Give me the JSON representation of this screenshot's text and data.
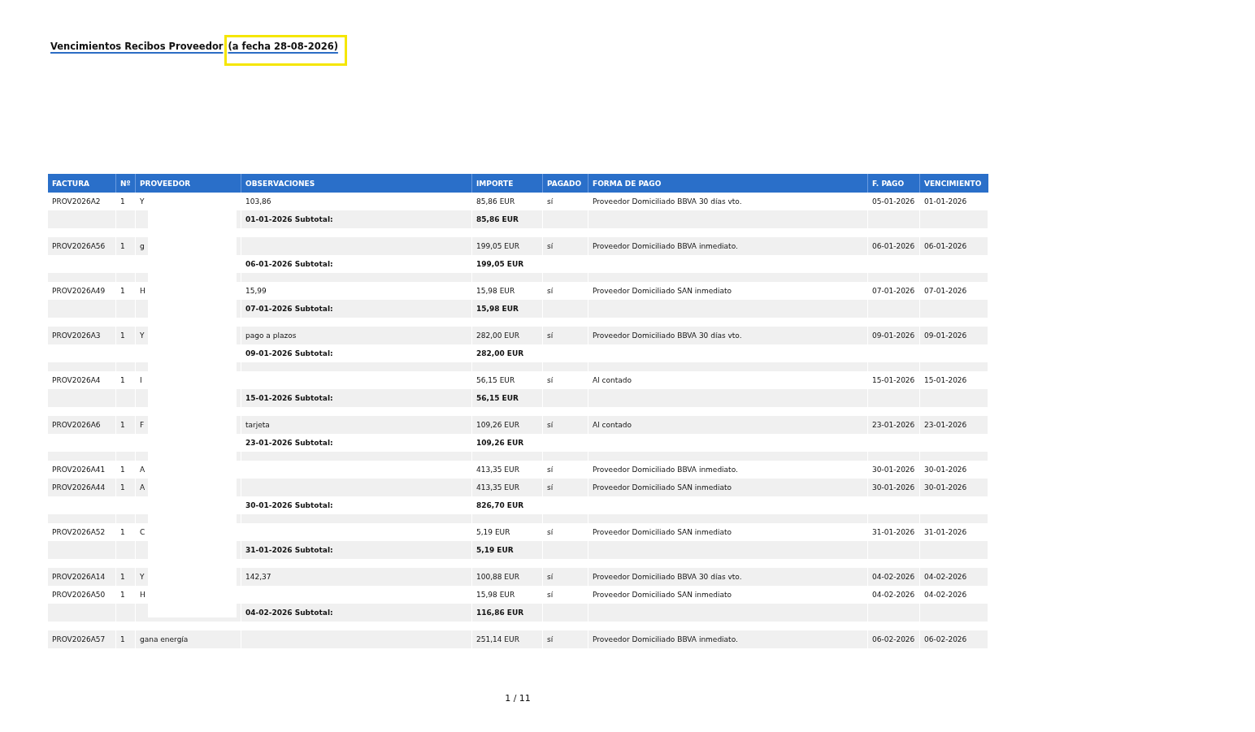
{
  "title": "Vencimientos Recibos Proveedor",
  "title_date": "(a fecha 28-08-2026)",
  "columns": [
    "FACTURA",
    "Nº",
    "PROVEEDOR",
    "OBSERVACIONES",
    "IMPORTE",
    "PAGADO",
    "FORMA DE PAGO",
    "F. PAGO",
    "VENCIMIENTO"
  ],
  "groups": [
    {
      "invoices": [
        {
          "factura": "PROV2026A2",
          "num": "1",
          "proveedor": "Y",
          "observaciones": "103,86",
          "importe": "85,86 EUR",
          "pagado": "sí",
          "forma_pago": "Proveedor Domiciliado BBVA 30 días vto.",
          "f_pago": "05-01-2026",
          "vencimiento": "01-01-2026"
        }
      ],
      "subtotal_label": "01-01-2026 Subtotal:",
      "subtotal": "85,86 EUR"
    },
    {
      "invoices": [
        {
          "factura": "PROV2026A56",
          "num": "1",
          "proveedor": "g",
          "importe": "199,05 EUR",
          "pagado": "sí",
          "forma_pago": "Proveedor Domiciliado BBVA inmediato.",
          "f_pago": "06-01-2026",
          "vencimiento": "06-01-2026"
        }
      ],
      "subtotal_label": "06-01-2026 Subtotal:",
      "subtotal": "199,05 EUR"
    },
    {
      "invoices": [
        {
          "factura": "PROV2026A49",
          "num": "1",
          "proveedor": "H",
          "observaciones": "15,99",
          "importe": "15,98 EUR",
          "pagado": "sí",
          "forma_pago": "Proveedor Domiciliado SAN inmediato",
          "f_pago": "07-01-2026",
          "vencimiento": "07-01-2026"
        }
      ],
      "subtotal_label": "07-01-2026 Subtotal:",
      "subtotal": "15,98 EUR"
    },
    {
      "invoices": [
        {
          "factura": "PROV2026A3",
          "num": "1",
          "proveedor": "Y",
          "observaciones": "pago a plazos",
          "importe": "282,00 EUR",
          "pagado": "sí",
          "forma_pago": "Proveedor Domiciliado BBVA 30 días vto.",
          "f_pago": "09-01-2026",
          "vencimiento": "09-01-2026"
        }
      ],
      "subtotal_label": "09-01-2026 Subtotal:",
      "subtotal": "282,00 EUR"
    },
    {
      "invoices": [
        {
          "factura": "PROV2026A4",
          "num": "1",
          "proveedor": "I",
          "importe": "56,15 EUR",
          "pagado": "sí",
          "forma_pago": "Al contado",
          "f_pago": "15-01-2026",
          "vencimiento": "15-01-2026"
        }
      ],
      "subtotal_label": "15-01-2026 Subtotal:",
      "subtotal": "56,15 EUR"
    },
    {
      "invoices": [
        {
          "factura": "PROV2026A6",
          "num": "1",
          "proveedor": "F",
          "observaciones": "tarjeta",
          "importe": "109,26 EUR",
          "pagado": "sí",
          "forma_pago": "Al contado",
          "f_pago": "23-01-2026",
          "vencimiento": "23-01-2026"
        }
      ],
      "subtotal_label": "23-01-2026 Subtotal:",
      "subtotal": "109,26 EUR"
    },
    {
      "invoices": [
        {
          "factura": "PROV2026A41",
          "num": "1",
          "proveedor": "A",
          "importe": "413,35 EUR",
          "pagado": "sí",
          "forma_pago": "Proveedor Domiciliado BBVA inmediato.",
          "f_pago": "30-01-2026",
          "vencimiento": "30-01-2026"
        },
        {
          "factura": "PROV2026A44",
          "num": "1",
          "proveedor": "A",
          "importe": "413,35 EUR",
          "pagado": "sí",
          "forma_pago": "Proveedor Domiciliado SAN inmediato",
          "f_pago": "30-01-2026",
          "vencimiento": "30-01-2026"
        }
      ],
      "subtotal_label": "30-01-2026 Subtotal:",
      "subtotal": "826,70 EUR"
    },
    {
      "invoices": [
        {
          "factura": "PROV2026A52",
          "num": "1",
          "proveedor": "C",
          "importe": "5,19 EUR",
          "pagado": "sí",
          "forma_pago": "Proveedor Domiciliado SAN inmediato",
          "f_pago": "31-01-2026",
          "vencimiento": "31-01-2026"
        }
      ],
      "subtotal_label": "31-01-2026 Subtotal:",
      "subtotal": "5,19 EUR"
    },
    {
      "invoices": [
        {
          "factura": "PROV2026A14",
          "num": "1",
          "proveedor": "Y",
          "observaciones": "142,37",
          "importe": "100,88 EUR",
          "pagado": "sí",
          "forma_pago": "Proveedor Domiciliado BBVA 30 días vto.",
          "f_pago": "04-02-2026",
          "vencimiento": "04-02-2026"
        },
        {
          "factura": "PROV2026A50",
          "num": "1",
          "proveedor": "H",
          "importe": "15,98 EUR",
          "pagado": "sí",
          "forma_pago": "Proveedor Domiciliado SAN inmediato",
          "f_pago": "04-02-2026",
          "vencimiento": "04-02-2026"
        }
      ],
      "subtotal_label": "04-02-2026 Subtotal:",
      "subtotal": "116,86 EUR"
    },
    {
      "invoices": [
        {
          "factura": "PROV2026A57",
          "num": "1",
          "proveedor": "gana energía",
          "importe": "251,14 EUR",
          "pagado": "sí",
          "forma_pago": "Proveedor Domiciliado BBVA inmediato.",
          "f_pago": "06-02-2026",
          "vencimiento": "06-02-2026"
        }
      ]
    }
  ],
  "page_number": "1 / 11"
}
